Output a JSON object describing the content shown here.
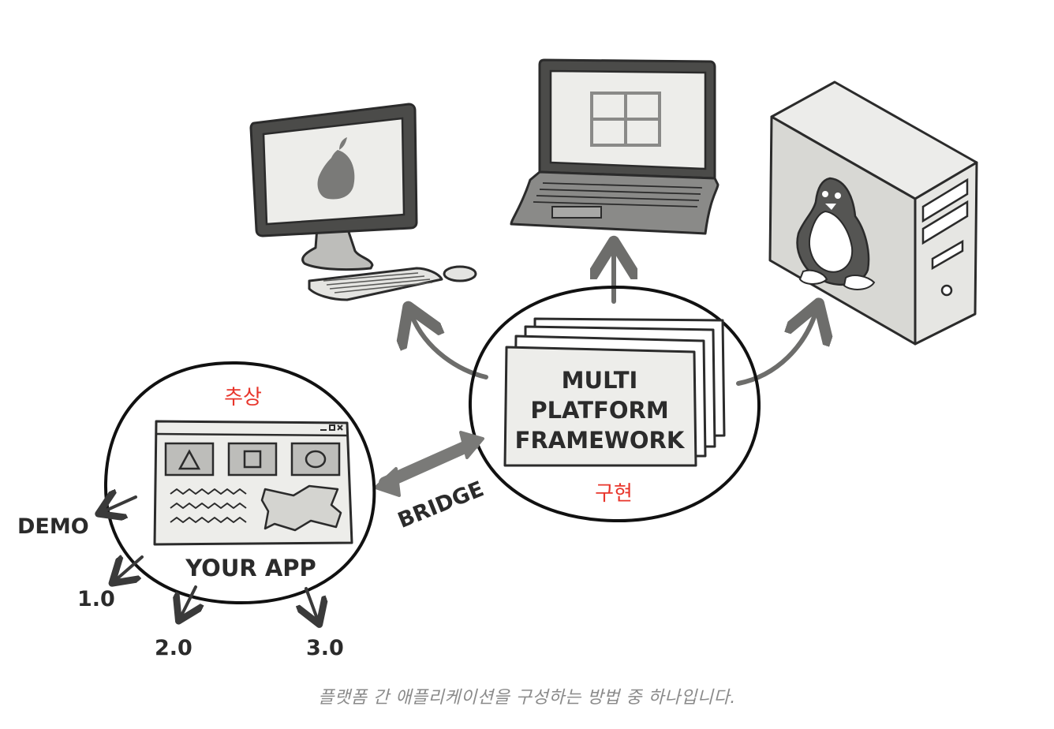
{
  "labels": {
    "abstraction": "추상",
    "implementation": "구현",
    "framework_line1": "MULTI",
    "framework_line2": "PLATFORM",
    "framework_line3": "FRAMEWORK",
    "app_name": "YOUR APP",
    "bridge": "BRIDGE",
    "demo": "DEMO",
    "v1": "1.0",
    "v2": "2.0",
    "v3": "3.0"
  },
  "caption": "플랫폼 간 애플리케이션을 구성하는 방법 중 하나입니다.",
  "colors": {
    "ink": "#2b2b2b",
    "arrow": "#6d6d6b",
    "accent": "#e8352b",
    "panel": "#ededea",
    "body": "#dcdcd8"
  },
  "icons": [
    "apple-logo-icon",
    "windows-logo-icon",
    "linux-penguin-icon"
  ]
}
